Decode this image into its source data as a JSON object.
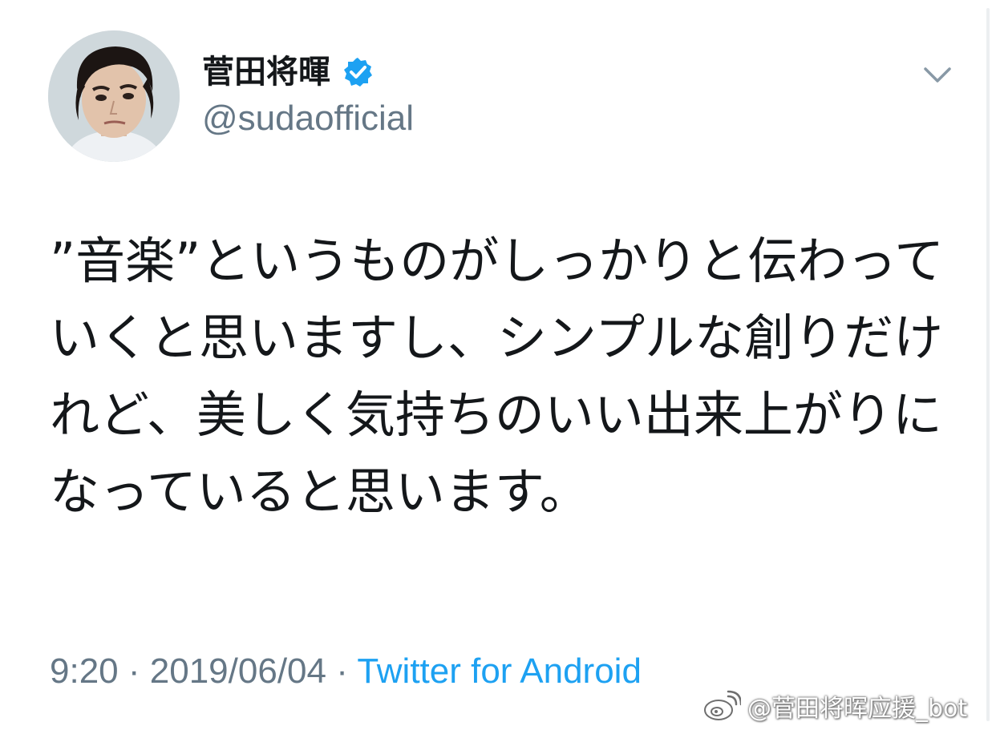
{
  "tweet": {
    "author": {
      "display_name": "菅田将暉",
      "handle": "@sudaofficial",
      "verified": true
    },
    "text": "”音楽”というものがしっかりと伝わっていくと思いますし、シンプルな創りだけれど、美しく気持ちのいい出来上がりになっていると思います。",
    "meta": {
      "time": "9:20",
      "date": "2019/06/04",
      "separator": "·",
      "source": "Twitter for Android"
    }
  },
  "watermark": {
    "text": "@菅田将晖应援_bot"
  },
  "colors": {
    "text": "#14171a",
    "secondary": "#657786",
    "accent": "#1da1f2",
    "verified_badge": "#1da1f2"
  },
  "icons": {
    "verified": "verified-badge-icon",
    "caret": "chevron-down-icon",
    "weibo": "weibo-logo-icon"
  }
}
